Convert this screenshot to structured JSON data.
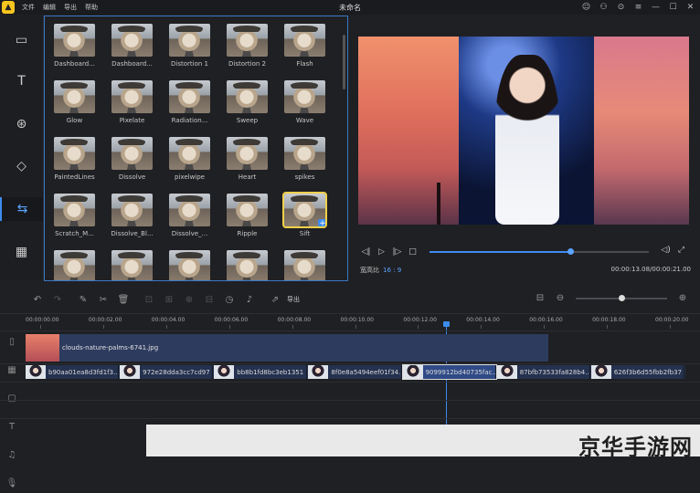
{
  "app": {
    "window_title": "未命名",
    "menu": [
      "文件",
      "编辑",
      "导出",
      "帮助"
    ],
    "titlebar_icons": [
      "chat-icon",
      "user-icon",
      "feedback-icon",
      "menu-icon",
      "minimize-icon",
      "maximize-icon",
      "close-icon"
    ]
  },
  "sidebar": {
    "items": [
      {
        "name": "media",
        "icon": "▭"
      },
      {
        "name": "text",
        "icon": "T"
      },
      {
        "name": "filters",
        "icon": "⊛"
      },
      {
        "name": "overlays",
        "icon": "◇"
      },
      {
        "name": "transitions",
        "icon": "⇆",
        "active": true
      },
      {
        "name": "film",
        "icon": "▦"
      }
    ]
  },
  "transitions": [
    {
      "label": "Dashboard..."
    },
    {
      "label": "Dashboard..."
    },
    {
      "label": "Distortion 1"
    },
    {
      "label": "Distortion 2"
    },
    {
      "label": "Flash"
    },
    {
      "label": "Glow"
    },
    {
      "label": "Pixelate"
    },
    {
      "label": "Radiation..."
    },
    {
      "label": "Sweep"
    },
    {
      "label": "Wave"
    },
    {
      "label": "PaintedLines"
    },
    {
      "label": "Dissolve"
    },
    {
      "label": "pixelwipe"
    },
    {
      "label": "Heart"
    },
    {
      "label": "spikes"
    },
    {
      "label": "Scratch_M..."
    },
    {
      "label": "Dissolve_Bl..."
    },
    {
      "label": "Dissolve_..."
    },
    {
      "label": "Ripple"
    },
    {
      "label": "Sift",
      "selected": true
    },
    {
      "label": ""
    },
    {
      "label": ""
    },
    {
      "label": ""
    },
    {
      "label": ""
    },
    {
      "label": ""
    }
  ],
  "player": {
    "aspect_label": "宽高比",
    "aspect_value": "16 : 9",
    "current_time": "00:00:13.08",
    "separator": "/",
    "total_time": "00:00:21.00",
    "progress": 0.64
  },
  "toolbar": {
    "export_label": "导出",
    "zoom_level": 0.5
  },
  "ruler": {
    "ticks": [
      "00:00:00.00",
      "00:00:02.00",
      "00:00:04.00",
      "00:00:06.00",
      "00:00:08.00",
      "00:00:10.00",
      "00:00:12.00",
      "00:00:14.00",
      "00:00:16.00",
      "00:00:18.00",
      "00:00:20.00"
    ]
  },
  "timeline": {
    "track1_clip": "clouds-nature-palms-6741.jpg",
    "track2_clips": [
      {
        "name": "b90aa01ea8d3fd1f3..."
      },
      {
        "name": "972e28dda3cc7cd97"
      },
      {
        "name": "bb8b1fd8bc3eb1351"
      },
      {
        "name": "8f0e8a5494eef01f34..."
      },
      {
        "name": "9099912bd40735fac...",
        "selected": true
      },
      {
        "name": "87bfb73533fa828b4..."
      },
      {
        "name": "626f3b6d55fbb2fb37"
      }
    ]
  },
  "watermark": "京华手游网"
}
